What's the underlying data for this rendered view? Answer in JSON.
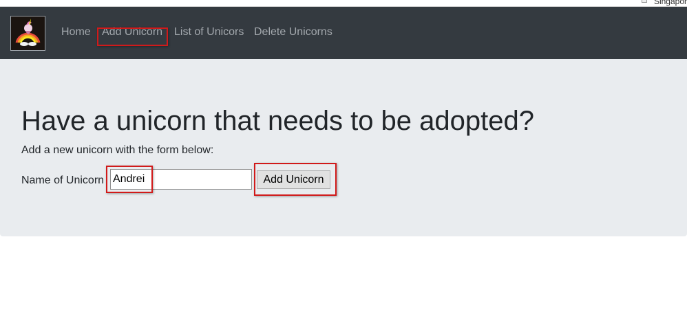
{
  "corner": {
    "text": "Singapor"
  },
  "navbar": {
    "logo_name": "unicorn-rainbow-logo",
    "links": [
      {
        "label": "Home"
      },
      {
        "label": "Add Unicorn"
      },
      {
        "label": "List of Unicors"
      },
      {
        "label": "Delete Unicorns"
      }
    ]
  },
  "main": {
    "headline": "Have a unicorn that needs to be adopted?",
    "subtext": "Add a new unicorn with the form below:",
    "form": {
      "label": "Name of Unicorn",
      "input_value": "Andrei",
      "submit_label": "Add Unicorn"
    }
  },
  "colors": {
    "navbar_bg": "#343a40",
    "nav_link": "#a4a9ae",
    "jumbotron_bg": "#e9ecef",
    "highlight": "#d11a1a"
  }
}
